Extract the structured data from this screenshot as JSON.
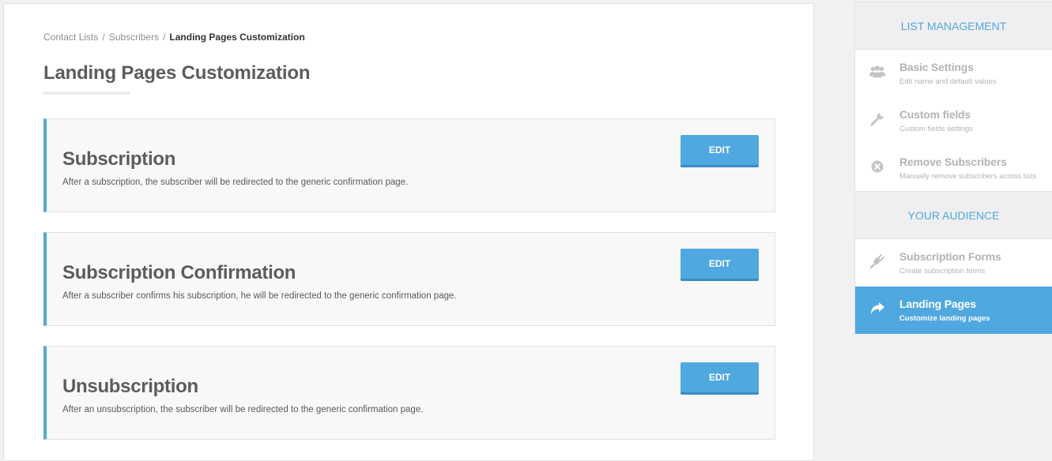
{
  "breadcrumb": {
    "items": [
      "Contact Lists",
      "Subscribers"
    ],
    "separator": "/",
    "current": "Landing Pages Customization"
  },
  "page": {
    "title": "Landing Pages Customization"
  },
  "cards": [
    {
      "title": "Subscription",
      "description": "After a subscription, the subscriber will be redirected to the generic confirmation page.",
      "button": "EDIT"
    },
    {
      "title": "Subscription Confirmation",
      "description": "After a subscriber confirms his subscription, he will be redirected to the generic confirmation page.",
      "button": "EDIT"
    },
    {
      "title": "Unsubscription",
      "description": "After an unsubscription, the subscriber will be redirected to the generic confirmation page.",
      "button": "EDIT"
    }
  ],
  "sidebar": {
    "list_management": {
      "header": "LIST MANAGEMENT",
      "items": [
        {
          "icon": "users-icon",
          "label": "Basic Settings",
          "desc": "Edit name and default values"
        },
        {
          "icon": "wrench-icon",
          "label": "Custom fields",
          "desc": "Custom fields settings"
        },
        {
          "icon": "remove-circle-icon",
          "label": "Remove Subscribers",
          "desc": "Manually remove subscribers across lists"
        }
      ]
    },
    "your_audience": {
      "header": "YOUR AUDIENCE",
      "items": [
        {
          "icon": "plug-icon",
          "label": "Subscription Forms",
          "desc": "Create subscription forms"
        },
        {
          "icon": "share-arrow-icon",
          "label": "Landing Pages",
          "desc": "Customize landing pages",
          "active": true
        }
      ]
    }
  },
  "colors": {
    "accent": "#4fa8e0",
    "accent_dark": "#3a8bc4",
    "card_bg": "#f8f8f8",
    "sidebar_header_bg": "#efefef",
    "muted_text": "#b4b4b4"
  }
}
